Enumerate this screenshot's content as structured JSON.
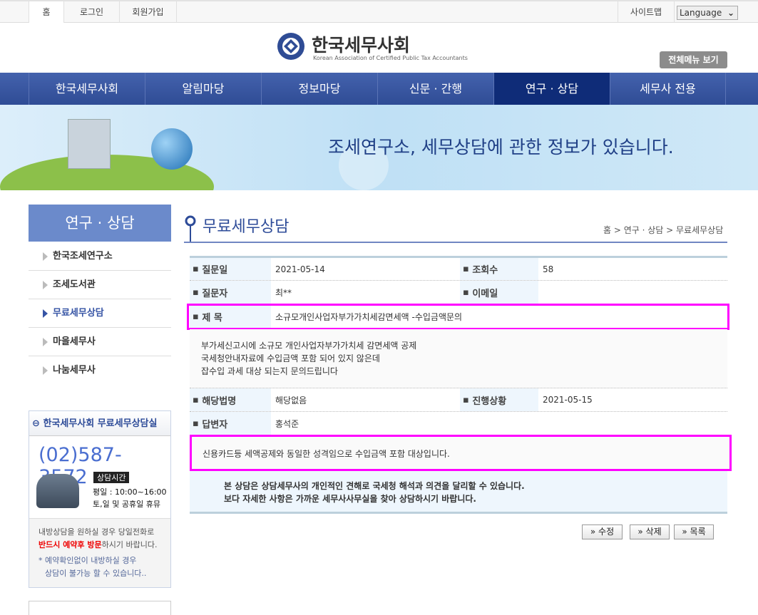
{
  "topbar": {
    "home": "홈",
    "login": "로그인",
    "join": "회원가입",
    "sitemap": "사이트맵",
    "language": "Language"
  },
  "logo": {
    "name": "한국세무사회",
    "sub": "Korean Association of Certified Public Tax Accountants"
  },
  "all_menu": "전체메뉴 보기",
  "nav": [
    "한국세무사회",
    "알림마당",
    "정보마당",
    "신문 · 간행",
    "연구 · 상담",
    "세무사 전용"
  ],
  "banner": "조세연구소, 세무상담에 관한 정보가 있습니다.",
  "sidebar": {
    "title": "연구 · 상담",
    "items": [
      "한국조세연구소",
      "조세도서관",
      "무료세무상담",
      "마을세무사",
      "나눔세무사"
    ]
  },
  "contact": {
    "title": "한국세무사회 무료세무상담실",
    "phone": "(02)587-3572",
    "hours_label": "상담시간",
    "weekday": "평일 : 10:00~16:00",
    "weekend": "토,일 및 공휴일 휴뮤",
    "note1": "내방상담을 원하실 경우 당일전화로",
    "note_red": "반드시 예약후 방문",
    "note2": "하시기 바랍니다.",
    "note3": "* 예약확인없이 내방하실 경우",
    "note4": "상담이 불가능 할 수 있습니다.."
  },
  "page": {
    "title": "무료세무상담",
    "breadcrumb": "홈 > 연구 · 상담 > 무료세무상담"
  },
  "detail": {
    "date_label": "질문일",
    "date": "2021-05-14",
    "views_label": "조회수",
    "views": "58",
    "asker_label": "질문자",
    "asker": "최**",
    "email_label": "이메일",
    "email": "",
    "subject_label": "제 목",
    "subject": "소규모개인사업자부가가치세감면세액 -수입금액문의",
    "question": [
      "부가세신고시에 소규모 개인사업자부가가치세 감면세액 공제",
      "국세청안내자료에 수입금액 포함 되어 있지 않은데",
      "잡수입 과세 대상 되는지 문의드립니다"
    ],
    "law_label": "해당법명",
    "law": "해당없음",
    "status_label": "진행상황",
    "status": "2021-05-15",
    "answerer_label": "답변자",
    "answerer": "홍석준",
    "answer": "신용카드등 세액공제와 동일한 성격임으로 수입금액 포함 대상입니다.",
    "notice1": "본 상담은 상담세무사의 개인적인 견해로 국세청 해석과 의견을 달리할 수 있습니다.",
    "notice2": "보다 자세한 사항은 가까운 세무사사무실을 찾아 상담하시기 바랍니다."
  },
  "buttons": {
    "edit": "» 수정",
    "delete": "» 삭제",
    "list": "» 목록"
  },
  "colors": {
    "nav": "#3a559f",
    "nav_active": "#0f2c78",
    "highlight": "#ff00ff"
  }
}
